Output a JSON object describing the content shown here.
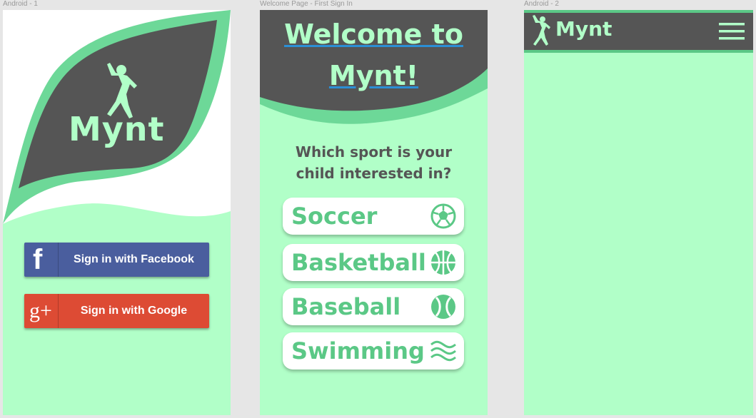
{
  "artboards": {
    "android1": "Android - 1",
    "welcome": "Welcome Page - First Sign In",
    "android2": "Android - 2"
  },
  "screen1": {
    "brand": "Mynt",
    "facebook_label": "Sign in with Facebook",
    "google_label": "Sign in with Google",
    "facebook_glyph": "f",
    "google_glyph": "g+"
  },
  "screen2": {
    "title_line1": "Welcome to",
    "title_line2": "Mynt!",
    "question_line1": "Which sport is your",
    "question_line2": "child interested in?",
    "sports": [
      {
        "label": "Soccer",
        "icon": "soccer-ball-icon"
      },
      {
        "label": "Basketball",
        "icon": "basketball-icon"
      },
      {
        "label": "Baseball",
        "icon": "baseball-icon"
      },
      {
        "label": "Swimming",
        "icon": "waves-icon"
      }
    ]
  },
  "screen3": {
    "brand": "Mynt",
    "menu_icon": "hamburger-menu-icon"
  },
  "colors": {
    "mint": "#b1ffc8",
    "green": "#5bc886",
    "dark": "#555555",
    "facebook": "#4a5e9e",
    "google": "#dd4b34"
  }
}
